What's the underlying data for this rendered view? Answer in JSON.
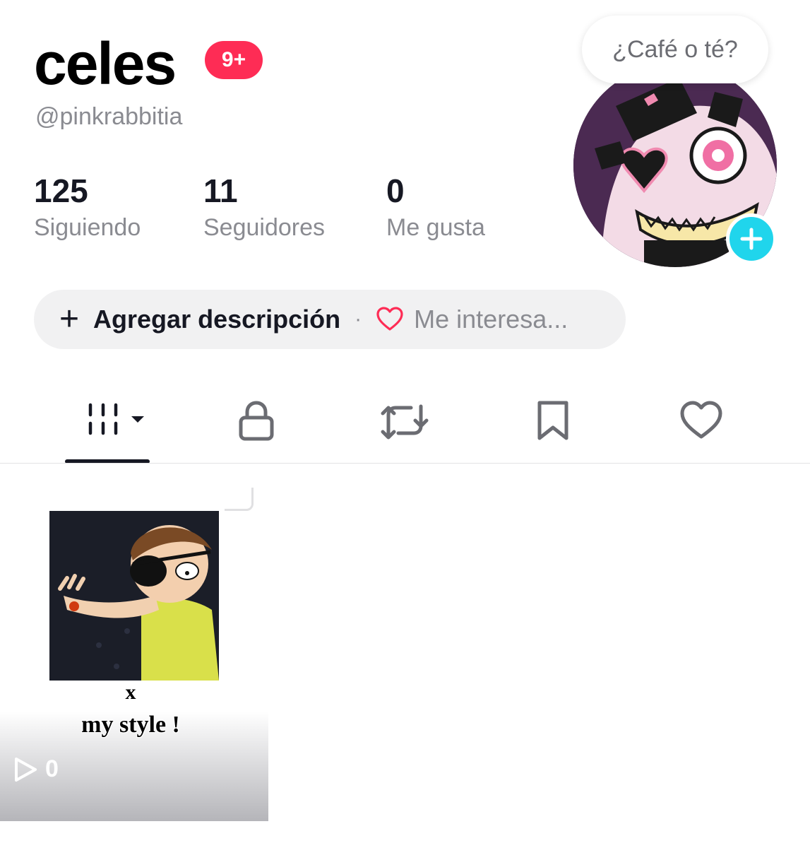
{
  "profile": {
    "display_name": "celes",
    "notification_badge": "9+",
    "handle": "@pinkrabbitia",
    "status_bubble": "¿Café o té?",
    "avatar_icon": "avatar-image"
  },
  "stats": [
    {
      "value": "125",
      "label": "Siguiendo"
    },
    {
      "value": "11",
      "label": "Seguidores"
    },
    {
      "value": "0",
      "label": "Me gusta"
    }
  ],
  "description_pill": {
    "add_label": "Agregar descripción",
    "separator": "·",
    "interests_label": "Me interesa..."
  },
  "tabs": [
    {
      "name": "videos",
      "icon": "grid-icon",
      "active": true
    },
    {
      "name": "private",
      "icon": "lock-icon",
      "active": false
    },
    {
      "name": "reposts",
      "icon": "repost-icon",
      "active": false
    },
    {
      "name": "favorites",
      "icon": "bookmark-icon",
      "active": false
    },
    {
      "name": "liked",
      "icon": "heart-icon",
      "active": false
    }
  ],
  "videos": [
    {
      "caption_line1": "x",
      "caption_line2": "my style !",
      "plays": "0"
    }
  ],
  "colors": {
    "badge": "#fe2c55",
    "avatar_add": "#20d5ec",
    "heart": "#fe2c55",
    "muted_text": "#8a8b91"
  }
}
